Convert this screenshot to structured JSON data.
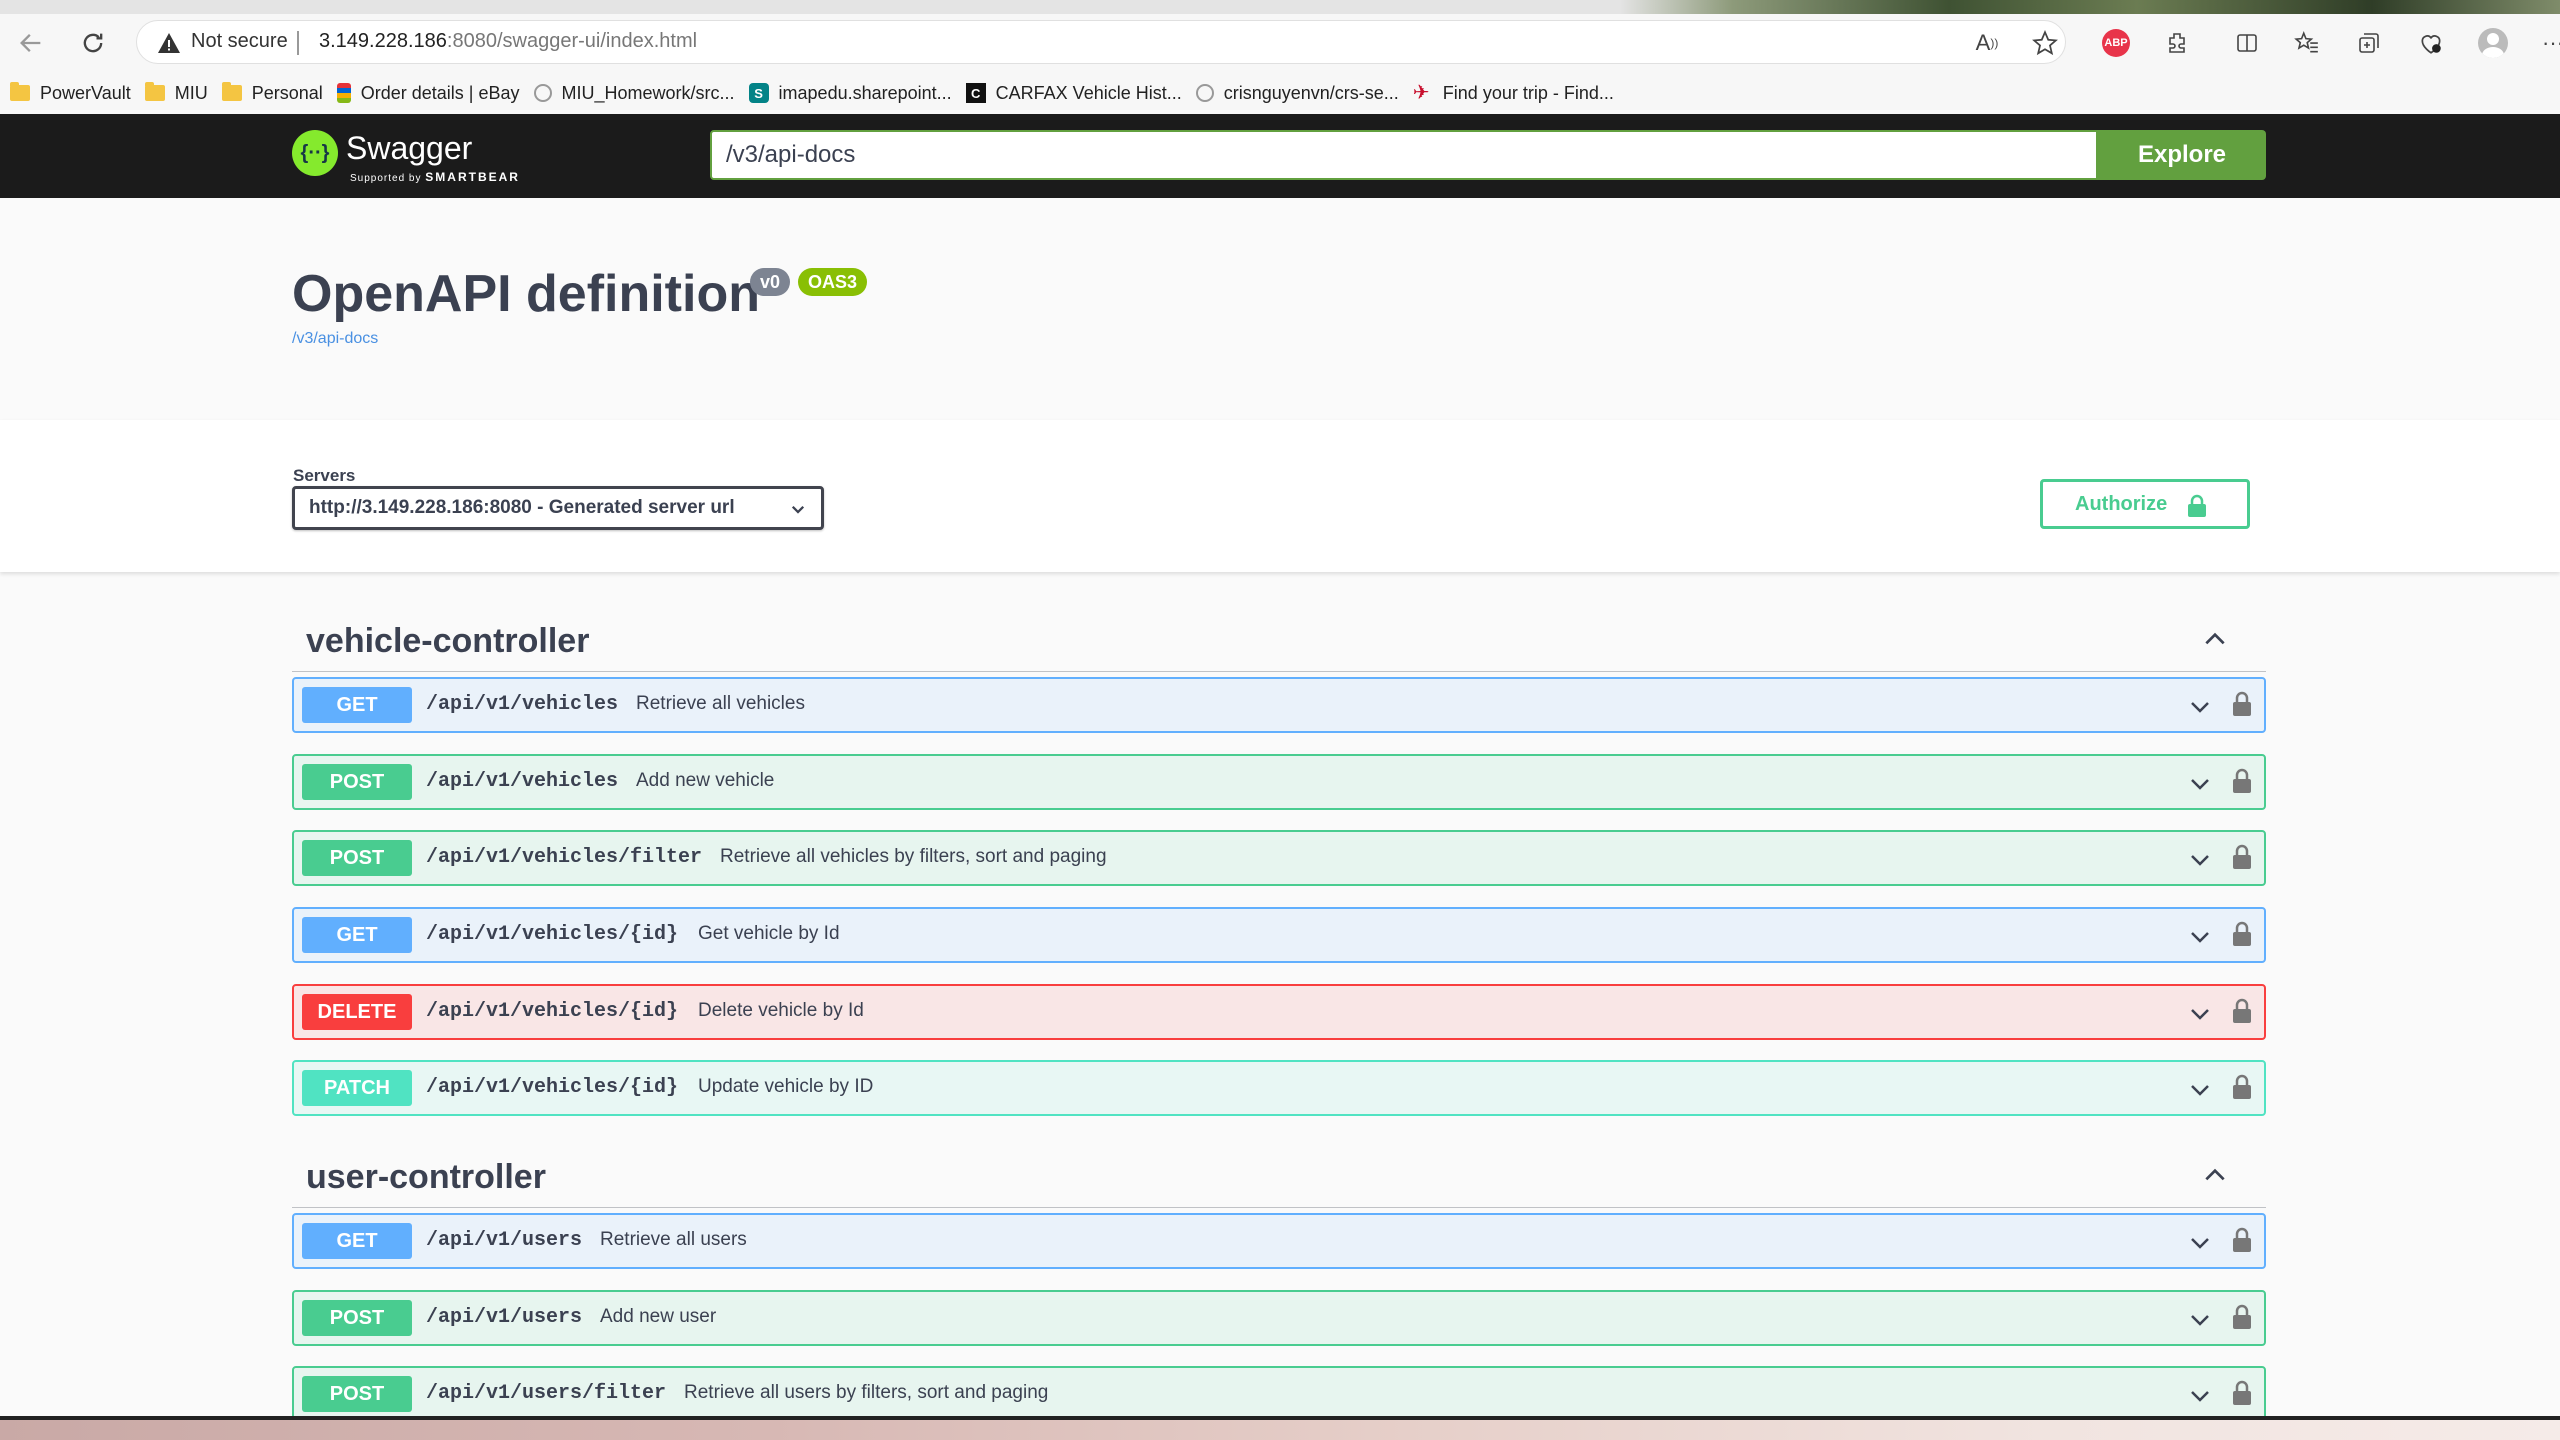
{
  "browser": {
    "not_secure": "Not secure",
    "url_host": "3.149.228.186",
    "url_path": ":8080/swagger-ui/index.html",
    "bookmarks": [
      {
        "label": "PowerVault",
        "icon": "folder-icon"
      },
      {
        "label": "MIU",
        "icon": "folder-icon"
      },
      {
        "label": "Personal",
        "icon": "folder-icon"
      },
      {
        "label": "Order details | eBay",
        "icon": "ebay-icon"
      },
      {
        "label": "MIU_Homework/src...",
        "icon": "globe-icon"
      },
      {
        "label": "imapedu.sharepoint...",
        "icon": "sharepoint-icon"
      },
      {
        "label": "CARFAX Vehicle Hist...",
        "icon": "carfax-icon"
      },
      {
        "label": "crisnguyenvn/crs-se...",
        "icon": "globe-icon"
      },
      {
        "label": "Find your trip - Find...",
        "icon": "airline-icon"
      }
    ]
  },
  "topbar": {
    "logo_text": "Swagger",
    "logo_sub_prefix": "Supported by",
    "logo_sub_brand": "SMARTBEAR",
    "spec_url": "/v3/api-docs",
    "explore_label": "Explore",
    "accent_color": "#62a03f"
  },
  "info": {
    "title": "OpenAPI definition",
    "version": "v0",
    "oas": "OAS3",
    "spec_link": "/v3/api-docs"
  },
  "servers": {
    "label": "Servers",
    "selected": "http://3.149.228.186:8080 - Generated server url",
    "authorize_label": "Authorize"
  },
  "colors": {
    "get": "#61affe",
    "post": "#49cc90",
    "delete": "#f93e3e",
    "patch": "#50e3c2"
  },
  "tags": [
    {
      "name": "vehicle-controller",
      "operations": [
        {
          "method": "GET",
          "path": "/api/v1/vehicles",
          "summary": "Retrieve all vehicles"
        },
        {
          "method": "POST",
          "path": "/api/v1/vehicles",
          "summary": "Add new vehicle"
        },
        {
          "method": "POST",
          "path": "/api/v1/vehicles/filter",
          "summary": "Retrieve all vehicles by filters, sort and paging"
        },
        {
          "method": "GET",
          "path": "/api/v1/vehicles/{id}",
          "summary": "Get vehicle by Id"
        },
        {
          "method": "DELETE",
          "path": "/api/v1/vehicles/{id}",
          "summary": "Delete vehicle by Id"
        },
        {
          "method": "PATCH",
          "path": "/api/v1/vehicles/{id}",
          "summary": "Update vehicle by ID"
        }
      ]
    },
    {
      "name": "user-controller",
      "operations": [
        {
          "method": "GET",
          "path": "/api/v1/users",
          "summary": "Retrieve all users"
        },
        {
          "method": "POST",
          "path": "/api/v1/users",
          "summary": "Add new user"
        },
        {
          "method": "POST",
          "path": "/api/v1/users/filter",
          "summary": "Retrieve all users by filters, sort and paging"
        }
      ]
    }
  ]
}
